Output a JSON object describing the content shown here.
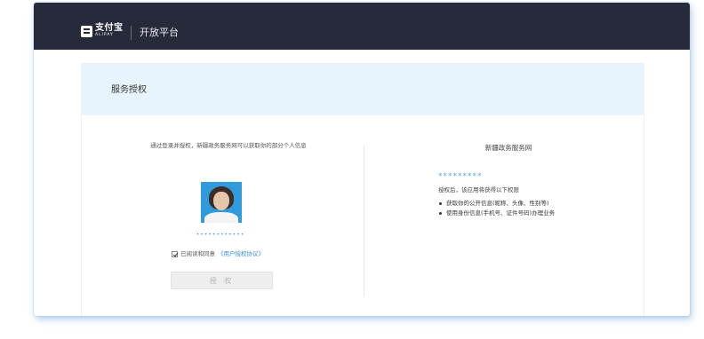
{
  "header": {
    "logo_cn": "支付宝",
    "logo_en": "ALIPAY",
    "platform_title": "开放平台"
  },
  "card": {
    "title": "服务授权"
  },
  "left": {
    "description": "通过登录并授权，新疆政务服务网可以获取你的部分个人信息",
    "masked_name": "••••••••••••",
    "agree_text": "已阅读和同意",
    "agree_link": "《用户授权协议》",
    "agree_checked": true,
    "authorize_button": "授 权"
  },
  "right": {
    "service_name": "新疆政务服务网",
    "masked_account": "*********",
    "subtitle": "授权后，该应用将获得以下权限",
    "permissions": [
      "获取你的公开信息(昵称、头像、性别等)",
      "使用身份信息(手机号、证件号码)办理业务"
    ]
  },
  "colors": {
    "topbar": "#272a3a",
    "card_header": "#e8f4fd",
    "link": "#3a90dd",
    "avatar_background": "#2f9bdc"
  }
}
